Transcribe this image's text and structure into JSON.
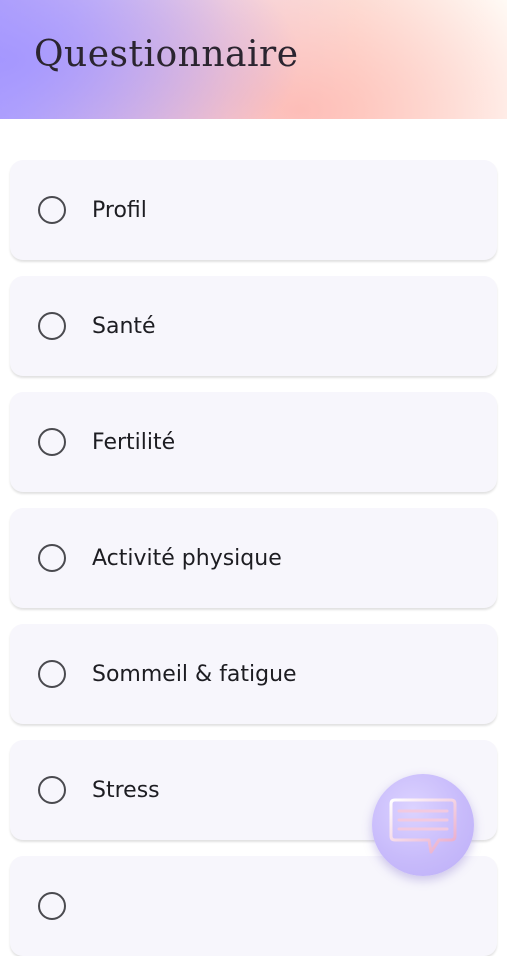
{
  "header": {
    "title": "Questionnaire"
  },
  "questionnaire": {
    "sections": [
      {
        "label": "Profil",
        "completed": false
      },
      {
        "label": "Santé",
        "completed": false
      },
      {
        "label": "Fertilité",
        "completed": false
      },
      {
        "label": "Activité physique",
        "completed": false
      },
      {
        "label": "Sommeil & fatigue",
        "completed": false
      },
      {
        "label": "Stress",
        "completed": false
      },
      {
        "label": "",
        "completed": false
      }
    ]
  },
  "colors": {
    "card_background": "#f7f6fc",
    "fab_accent": "#c8bbfb",
    "header_gradient_start": "#b7a9fb",
    "header_gradient_end": "#fde6de"
  },
  "icons": {
    "fab": "chat-bubble-icon",
    "section_status": "radio-unchecked-icon"
  }
}
